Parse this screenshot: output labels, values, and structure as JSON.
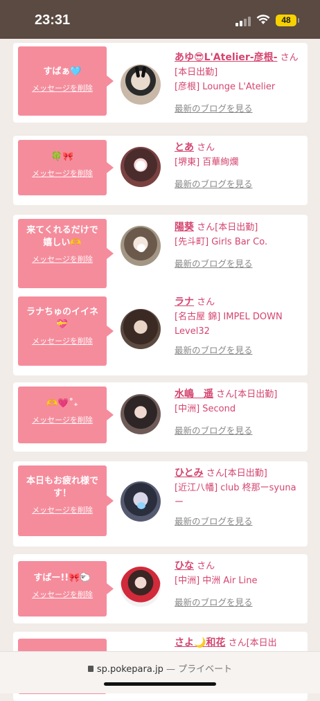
{
  "status": {
    "time": "23:31",
    "battery": "48"
  },
  "cards": [
    {
      "message": "すばぁ🩵",
      "delete_label": "メッセージを削除",
      "name": "あゆ😎L'Atelier-彦根-",
      "suffix": "さん[本日出勤]",
      "shop": "[彦根] Lounge L'Atelier",
      "blog": "最新のブログを見る"
    },
    {
      "message": "🍀🎀",
      "delete_label": "メッセージを削除",
      "name": "とあ",
      "suffix": "さん",
      "shop": "[堺東] 百華絢爛",
      "blog": "最新のブログを見る"
    },
    {
      "message": "来てくれるだけで嬉しい🫶",
      "delete_label": "メッセージを削除",
      "name": "陽葵",
      "suffix": "さん[本日出勤]",
      "shop": "[先斗町] Girls Bar Co.",
      "blog": "最新のブログを見る"
    },
    {
      "message": "ラナちゅのイイネ💝",
      "delete_label": "メッセージを削除",
      "name": "ラナ",
      "suffix": "さん",
      "shop": "[名古屋 錦] IMPEL DOWN Level32",
      "blog": "最新のブログを見る"
    },
    {
      "message": "🫶💗˚₊",
      "delete_label": "メッセージを削除",
      "name": "水嶋　遥",
      "suffix": "さん[本日出勤]",
      "shop": "[中洲] Second",
      "blog": "最新のブログを見る"
    },
    {
      "message": "本日もお疲れ様です！",
      "delete_label": "メッセージを削除",
      "name": "ひとみ",
      "suffix": "さん[本日出勤]",
      "shop": "[近江八幡] club 柊那ーsyunaー",
      "blog": "最新のブログを見る"
    },
    {
      "message": "すばー!!🎀🐑",
      "delete_label": "メッセージを削除",
      "name": "ひな",
      "suffix": "さん",
      "shop": "[中洲] 中洲 Air Line",
      "blog": "最新のブログを見る"
    },
    {
      "message": "",
      "delete_label": "",
      "name": "さよ🌙和花",
      "suffix": "さん[本日出",
      "shop": "",
      "blog": ""
    }
  ],
  "browser": {
    "domain": "sp.pokepara.jp",
    "separator": "—",
    "mode": "プライベート"
  }
}
